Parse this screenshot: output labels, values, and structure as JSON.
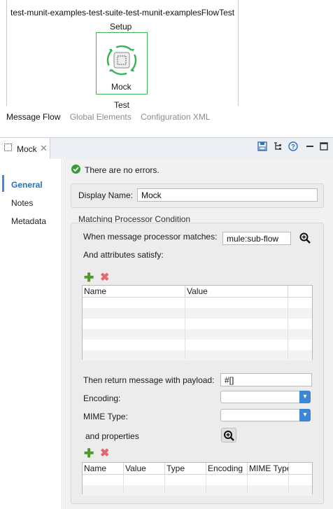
{
  "canvas": {
    "flow_title": "test-munit-examples-test-suite-test-munit-examplesFlowTest",
    "setup_label": "Setup",
    "mock_label": "Mock",
    "test_label": "Test"
  },
  "view_tabs": [
    "Message Flow",
    "Global Elements",
    "Configuration XML"
  ],
  "properties": {
    "tab_label": "Mock",
    "status_text": "There are no errors.",
    "sidebar": [
      "General",
      "Notes",
      "Metadata"
    ],
    "display_name_label": "Display Name:",
    "display_name_value": "Mock",
    "matching_group_label": "Matching Processor Condition",
    "when_label": "When message processor matches:",
    "when_value": "mule:sub-flow",
    "attributes_label": "And attributes satisfy:",
    "attributes_columns": [
      "Name",
      "Value"
    ],
    "payload_label": "Then return message with payload:",
    "payload_value": "#[]",
    "encoding_label": "Encoding:",
    "encoding_value": "",
    "mime_label": "MIME Type:",
    "mime_value": "",
    "and_properties_label": "and properties",
    "properties_columns": [
      "Name",
      "Value",
      "Type",
      "Encoding",
      "MIME Type"
    ]
  },
  "colors": {
    "accent_green": "#3cb55a",
    "accent_blue": "#3b86d6",
    "delete_red": "#e06a6a"
  }
}
